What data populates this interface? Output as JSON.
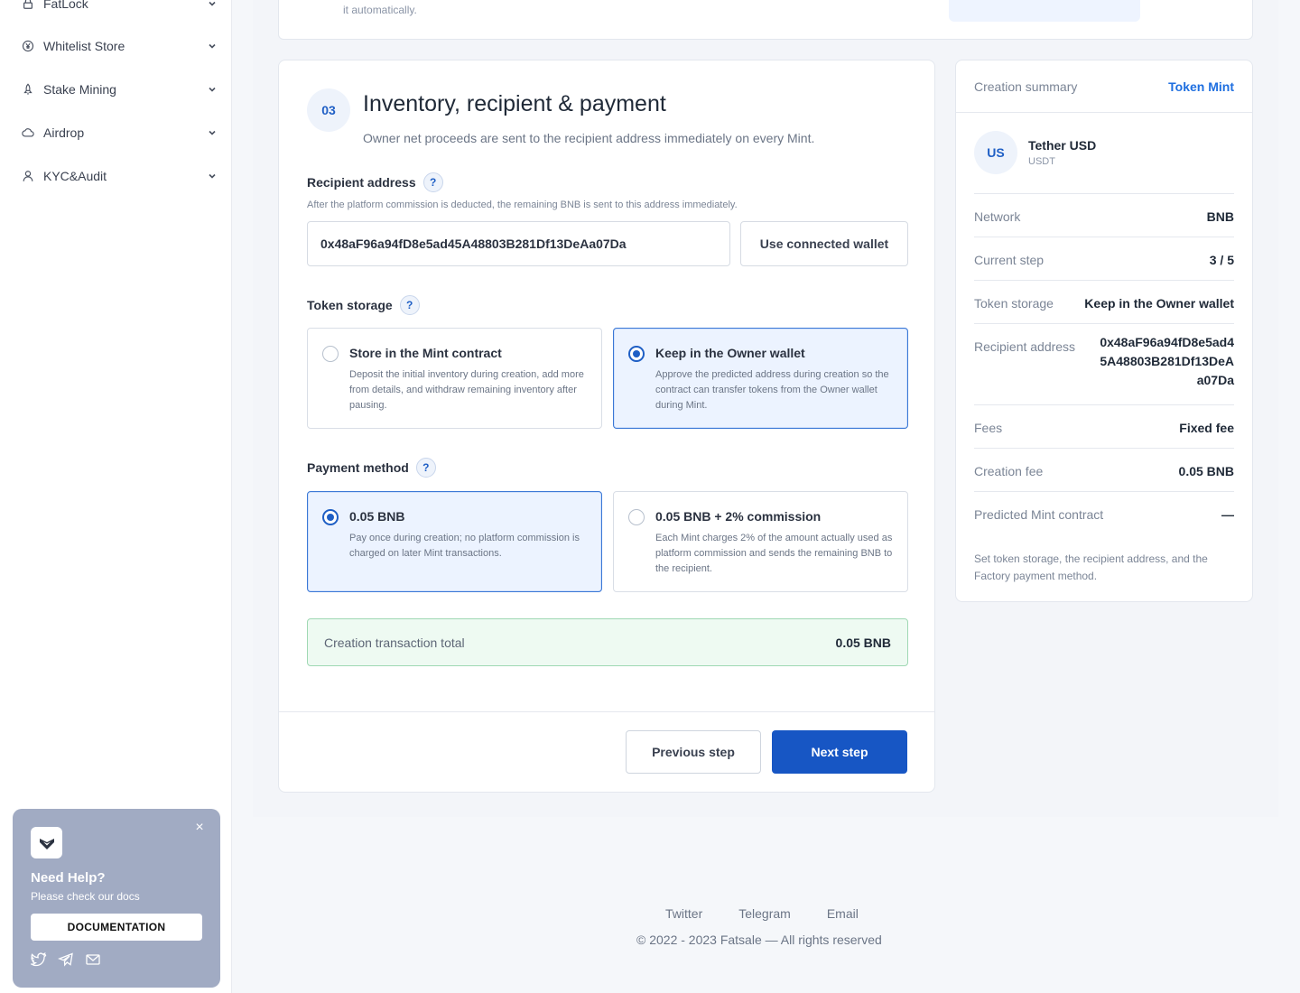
{
  "sidebar": {
    "items": [
      {
        "label": "FatLock",
        "icon": "lock-icon"
      },
      {
        "label": "Whitelist Store",
        "icon": "yen-circle-icon"
      },
      {
        "label": "Stake Mining",
        "icon": "rocket-icon"
      },
      {
        "label": "Airdrop",
        "icon": "cloud-icon"
      },
      {
        "label": "KYC&Audit",
        "icon": "user-icon"
      }
    ]
  },
  "help": {
    "title": "Need Help?",
    "subtitle": "Please check our docs",
    "button": "DOCUMENTATION"
  },
  "top": {
    "hint": "it automatically."
  },
  "step": {
    "number": "03",
    "title": "Inventory, recipient & payment",
    "subtitle": "Owner net proceeds are sent to the recipient address immediately on every Mint."
  },
  "recipient": {
    "label": "Recipient address",
    "hint": "After the platform commission is deducted, the remaining BNB is sent to this address immediately.",
    "value": "0x48aF96a94fD8e5ad45A48803B281Df13DeAa07Da",
    "wallet_button": "Use connected wallet"
  },
  "storage": {
    "label": "Token storage",
    "options": [
      {
        "title": "Store in the Mint contract",
        "desc": "Deposit the initial inventory during creation, add more from details, and withdraw remaining inventory after pausing.",
        "selected": false
      },
      {
        "title": "Keep in the Owner wallet",
        "desc": "Approve the predicted address during creation so the contract can transfer tokens from the Owner wallet during Mint.",
        "selected": true
      }
    ]
  },
  "payment": {
    "label": "Payment method",
    "options": [
      {
        "title": "0.05 BNB",
        "desc": "Pay once during creation; no platform commission is charged on later Mint transactions.",
        "selected": true
      },
      {
        "title": "0.05 BNB + 2% commission",
        "desc": "Each Mint charges 2% of the amount actually used as platform commission and sends the remaining BNB to the recipient.",
        "selected": false
      }
    ]
  },
  "total": {
    "label": "Creation transaction total",
    "value": "0.05 BNB"
  },
  "actions": {
    "previous": "Previous step",
    "next": "Next step"
  },
  "summary": {
    "title": "Creation summary",
    "type": "Token Mint",
    "token": {
      "avatar": "US",
      "name": "Tether USD",
      "symbol": "USDT"
    },
    "rows": [
      {
        "k": "Network",
        "v": "BNB"
      },
      {
        "k": "Current step",
        "v": "3 / 5"
      },
      {
        "k": "Token storage",
        "v": "Keep in the Owner wallet"
      },
      {
        "k": "Recipient address",
        "v": "0x48aF96a94fD8e5ad45A48803B281Df13DeAa07Da"
      },
      {
        "k": "Fees",
        "v": "Fixed fee"
      },
      {
        "k": "Creation fee",
        "v": "0.05 BNB"
      },
      {
        "k": "Predicted Mint contract",
        "v": "—"
      }
    ],
    "note": "Set token storage, the recipient address, and the Factory payment method."
  },
  "footer": {
    "links": [
      "Twitter",
      "Telegram",
      "Email"
    ],
    "copyright": "© 2022 - 2023 Fatsale — All rights reserved"
  },
  "colors": {
    "accent": "#1756c4",
    "selected_bg": "#ecf3ff",
    "total_bg": "#eefaf2",
    "help_bg": "#a1abc3"
  }
}
